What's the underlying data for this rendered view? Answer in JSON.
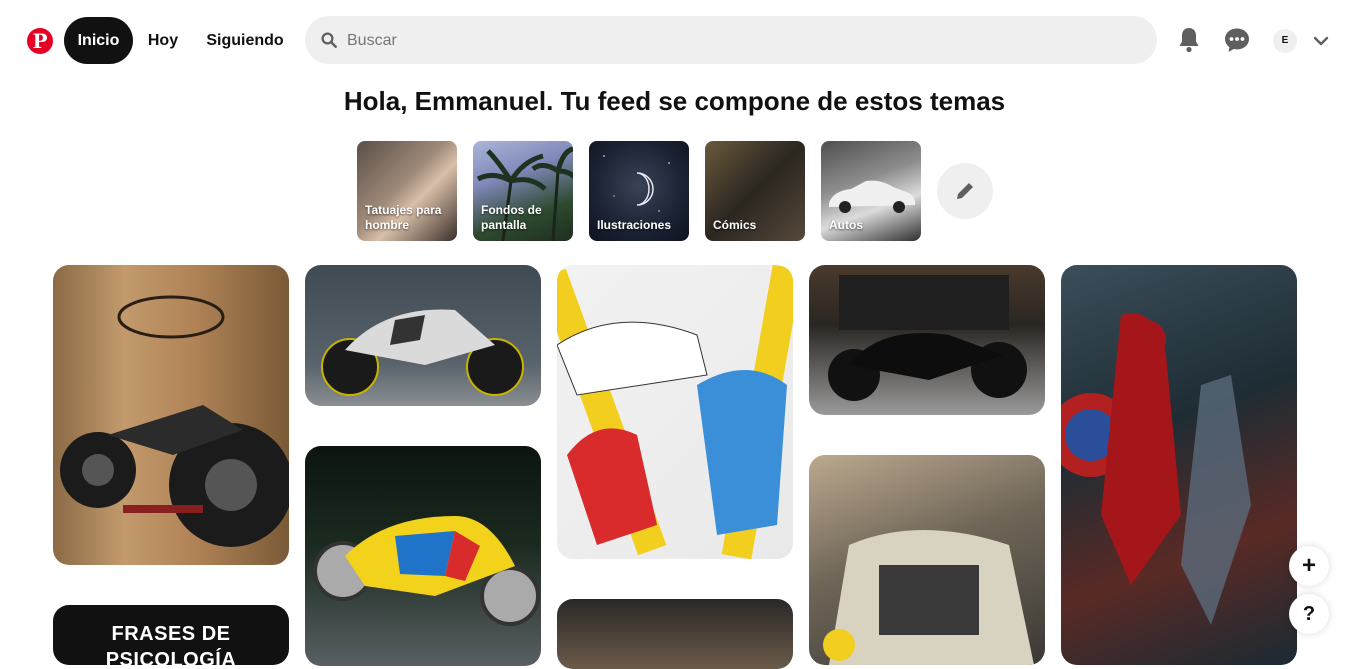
{
  "header": {
    "logo": "P",
    "nav": [
      {
        "label": "Inicio",
        "active": true
      },
      {
        "label": "Hoy",
        "active": false
      },
      {
        "label": "Siguiendo",
        "active": false
      }
    ],
    "search_placeholder": "Buscar",
    "avatar_initial": "E"
  },
  "headline": "Hola, Emmanuel. Tu feed se compone de estos temas",
  "topics": [
    {
      "label": "Tatuajes para hombre"
    },
    {
      "label": "Fondos de pantalla"
    },
    {
      "label": "Ilustraciones"
    },
    {
      "label": "Cómics"
    },
    {
      "label": "Autos"
    }
  ],
  "pins": {
    "text_pin_line1": "FRASES DE",
    "text_pin_line2": "PSICOLOGÍA"
  },
  "floating": {
    "plus": "+",
    "help": "?"
  },
  "colors": {
    "brand": "#e60023",
    "active_nav": "#111111",
    "search_bg": "#efefef"
  },
  "icons": [
    "search-icon",
    "bell-icon",
    "chat-icon",
    "chevron-down-icon",
    "pencil-icon"
  ]
}
